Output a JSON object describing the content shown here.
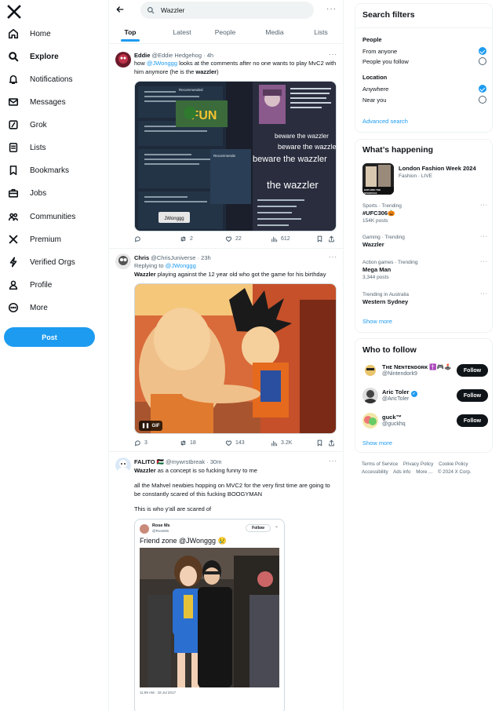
{
  "nav": {
    "items": [
      {
        "label": "Home",
        "icon": "home-icon"
      },
      {
        "label": "Explore",
        "icon": "search-icon"
      },
      {
        "label": "Notifications",
        "icon": "bell-icon"
      },
      {
        "label": "Messages",
        "icon": "envelope-icon"
      },
      {
        "label": "Grok",
        "icon": "grok-icon"
      },
      {
        "label": "Lists",
        "icon": "list-icon"
      },
      {
        "label": "Bookmarks",
        "icon": "bookmark-icon"
      },
      {
        "label": "Jobs",
        "icon": "briefcase-icon"
      },
      {
        "label": "Communities",
        "icon": "people-icon"
      },
      {
        "label": "Premium",
        "icon": "x-logo-icon"
      },
      {
        "label": "Verified Orgs",
        "icon": "lightning-icon"
      },
      {
        "label": "Profile",
        "icon": "person-icon"
      },
      {
        "label": "More",
        "icon": "more-circle-icon"
      }
    ],
    "post_label": "Post"
  },
  "search": {
    "query": "Wazzler"
  },
  "tabs": [
    "Top",
    "Latest",
    "People",
    "Media",
    "Lists"
  ],
  "tweets": [
    {
      "name": "Eddie",
      "handle": "@Eddie Hedgehog",
      "time": "· 4h",
      "text_pre": "how ",
      "mention": "@JWonggg",
      "text_mid": " looks at the comments after no one wants to play MvC2 with him anymore (he is the ",
      "text_bold": "wazzler",
      "text_end": ")",
      "media_texts": {
        "fun": "FUN",
        "b1": "beware the wazzler",
        "b2": "beware the wazzler",
        "b3": "beware the wazzler",
        "b4": "the wazzler",
        "btn": "JWonggg",
        "rec": "Recommended",
        "rec2": "Recommende"
      },
      "stats": {
        "replies": "",
        "reposts": "2",
        "likes": "22",
        "views": "612"
      }
    },
    {
      "name": "Chris",
      "handle": "@ChrisJuniverse",
      "time": "· 23h",
      "replying_label": "Replying to ",
      "replying_to": "@JWonggg",
      "text_bold": "Wazzler",
      "text": " playing against the 12 year old who got the game for his birthday",
      "gif_label": "GIF",
      "stats": {
        "replies": "3",
        "reposts": "18",
        "likes": "143",
        "views": "3.2K"
      }
    },
    {
      "name": "FALITO 🇵🇸",
      "handle": "@mywrstbreak",
      "time": "· 30m",
      "text_bold": "Wazzler",
      "text": " as a concept is so fucking funny to me",
      "p2": "all the Mahvel newbies hopping on MVC2 for the very first time are going to be constantly scared of this fucking BOOGYMAN",
      "p3": "This is who y'all are scared of",
      "quote": {
        "name": "Rose Ms",
        "handle": "@RoseMs",
        "follow_label": "Follow",
        "text": "Friend zone @JWonggg 😢",
        "footer": "11:59 AM · 18 Jul 2017"
      }
    }
  ],
  "filters": {
    "title": "Search filters",
    "people_title": "People",
    "people": [
      {
        "label": "From anyone",
        "selected": true
      },
      {
        "label": "People you follow",
        "selected": false
      }
    ],
    "location_title": "Location",
    "location": [
      {
        "label": "Anywhere",
        "selected": true
      },
      {
        "label": "Near you",
        "selected": false
      }
    ],
    "advanced": "Advanced search"
  },
  "happening": {
    "title": "What’s happening",
    "event": {
      "title": "London Fashion Week 2024",
      "meta": "Fashion · LIVE",
      "thumb_text": "EXPLORE THE SCHEDULE"
    },
    "trends": [
      {
        "category": "Sports · Trending",
        "title": "#UFC306🎃",
        "count": "154K posts"
      },
      {
        "category": "Gaming · Trending",
        "title": "Wazzler",
        "count": ""
      },
      {
        "category": "Action games · Trending",
        "title": "Mega Man",
        "count": "3,344 posts"
      },
      {
        "category": "Trending in Australia",
        "title": "Western Sydney",
        "count": ""
      }
    ],
    "show_more": "Show more"
  },
  "who_to_follow": {
    "title": "Who to follow",
    "accounts": [
      {
        "name": "Tʜᴇ Nᴇɴᴛᴇɴᴅᴏʀᴋ ✝️🎮🕹️",
        "handle": "@Nintendork9"
      },
      {
        "name": "Aric Toler",
        "handle": "@AricToler"
      },
      {
        "name": "guck™",
        "handle": "@guckhq"
      }
    ],
    "follow_label": "Follow",
    "show_more": "Show more"
  },
  "footer": {
    "links": [
      "Terms of Service",
      "Privacy Policy",
      "Cookie Policy",
      "Accessibility",
      "Ads info",
      "More ...",
      "© 2024 X Corp."
    ]
  },
  "colors": {
    "accent": "#1d9bf0",
    "text": "#0f1419",
    "muted": "#536471",
    "border": "#eff3f4"
  }
}
